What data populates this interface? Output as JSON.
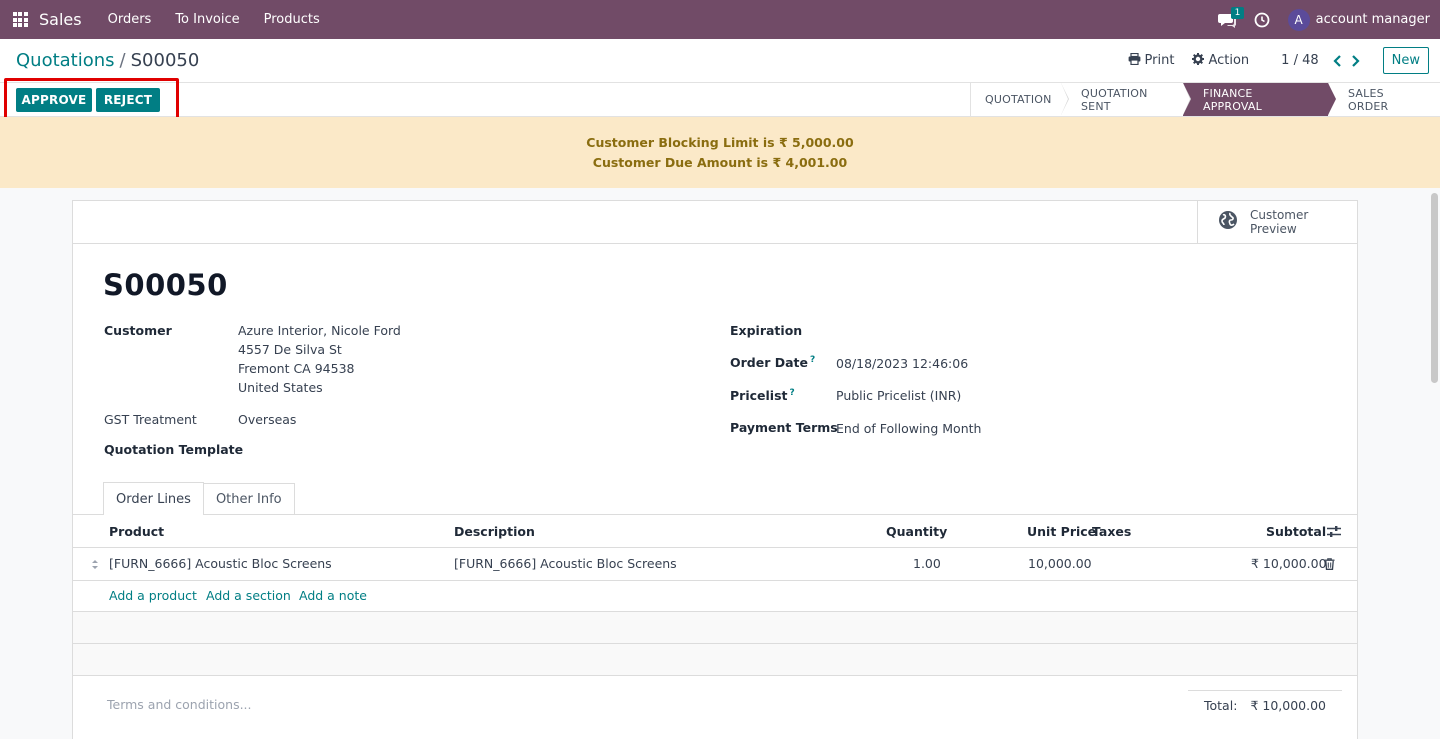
{
  "navbar": {
    "app_name": "Sales",
    "menu": [
      "Orders",
      "To Invoice",
      "Products"
    ],
    "chat_count": "1",
    "user_initial": "A",
    "user_name": "account manager"
  },
  "control": {
    "breadcrumb_parent": "Quotations",
    "breadcrumb_separator": "/",
    "breadcrumb_current": "S00050",
    "print_label": "Print",
    "action_label": "Action",
    "pager": "1 / 48",
    "new_label": "New"
  },
  "statusbar": {
    "approve_label": "APPROVE",
    "reject_label": "REJECT",
    "stages": [
      "QUOTATION",
      "QUOTATION SENT",
      "FINANCE APPROVAL",
      "SALES ORDER"
    ],
    "active_stage": "FINANCE APPROVAL"
  },
  "alert": {
    "line1": "Customer Blocking Limit is ₹ 5,000.00",
    "line2": "Customer Due Amount is ₹ 4,001.00"
  },
  "sheet": {
    "preview_line1": "Customer",
    "preview_line2": "Preview",
    "title": "S00050",
    "customer_label": "Customer",
    "customer_lines": [
      "Azure Interior, Nicole Ford",
      "4557 De Silva St",
      "Fremont CA 94538",
      "United States"
    ],
    "gst_label": "GST Treatment",
    "gst_value": "Overseas",
    "template_label": "Quotation Template",
    "expiration_label": "Expiration",
    "order_date_label": "Order Date",
    "order_date_value": "08/18/2023 12:46:06",
    "pricelist_label": "Pricelist",
    "pricelist_value": "Public Pricelist (INR)",
    "payment_terms_label": "Payment Terms",
    "payment_terms_value": "End of Following Month",
    "help_mark": "?"
  },
  "tabs": [
    "Order Lines",
    "Other Info"
  ],
  "table": {
    "headers": {
      "product": "Product",
      "description": "Description",
      "quantity": "Quantity",
      "unit_price": "Unit Price",
      "taxes": "Taxes",
      "subtotal": "Subtotal"
    },
    "rows": [
      {
        "product": "[FURN_6666] Acoustic Bloc Screens",
        "description": "[FURN_6666] Acoustic Bloc Screens",
        "quantity": "1.00",
        "unit_price": "10,000.00",
        "subtotal": "₹ 10,000.00"
      }
    ],
    "add_product": "Add a product",
    "add_section": "Add a section",
    "add_note": "Add a note"
  },
  "footer": {
    "terms_placeholder": "Terms and conditions...",
    "total_label": "Total:",
    "total_value": "₹ 10,000.00"
  },
  "colors": {
    "brand": "#714b67",
    "accent": "#017e84",
    "alert_bg": "#fbe9c8",
    "highlight": "#e00000"
  }
}
